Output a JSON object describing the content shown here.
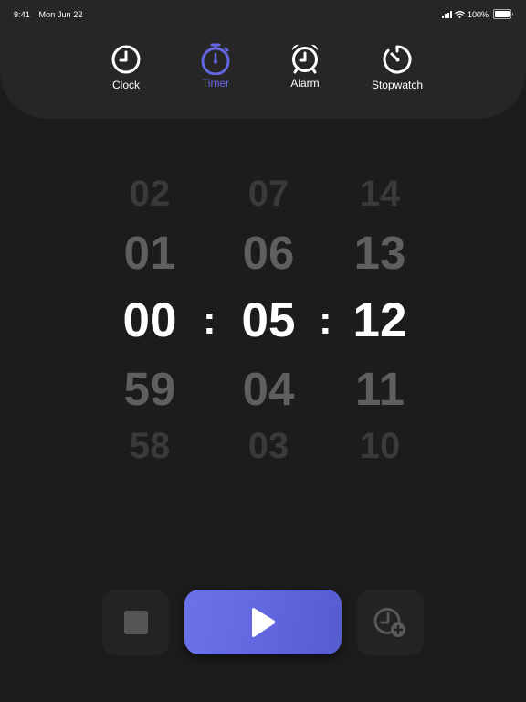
{
  "status_bar": {
    "time": "9:41",
    "date": "Mon Jun 22",
    "battery_percent": "100%",
    "icons": [
      "cellular-signal-icon",
      "wifi-icon",
      "battery-icon"
    ]
  },
  "nav": {
    "active_color": "#6466e3",
    "tabs": [
      {
        "label": "Clock",
        "icon": "clock-icon",
        "active": false
      },
      {
        "label": "Timer",
        "icon": "stopwatch-timer-icon",
        "active": true
      },
      {
        "label": "Alarm",
        "icon": "alarm-clock-icon",
        "active": false
      },
      {
        "label": "Stopwatch",
        "icon": "stopwatch-dial-icon",
        "active": false
      }
    ]
  },
  "timer_picker": {
    "separator": ":",
    "columns": [
      {
        "name": "hours",
        "values": [
          "02",
          "01",
          "00",
          "59",
          "58"
        ],
        "selected": "00"
      },
      {
        "name": "minutes",
        "values": [
          "07",
          "06",
          "05",
          "04",
          "03"
        ],
        "selected": "05"
      },
      {
        "name": "seconds",
        "values": [
          "14",
          "13",
          "12",
          "11",
          "10"
        ],
        "selected": "12"
      }
    ]
  },
  "controls": {
    "stop": {
      "icon": "stop-icon"
    },
    "play": {
      "icon": "play-icon",
      "color": "#6367e0"
    },
    "add_time": {
      "icon": "clock-plus-icon"
    }
  }
}
